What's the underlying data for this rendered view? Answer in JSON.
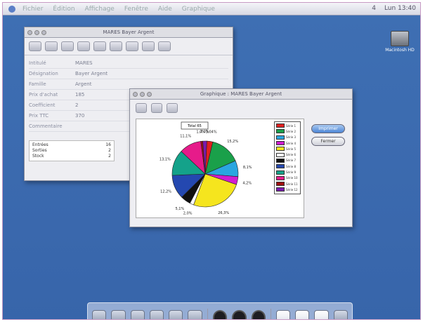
{
  "menubar": {
    "items": [
      "Fichier",
      "Édition",
      "Affichage",
      "Fenêtre",
      "Aide",
      "Graphique"
    ],
    "status": "4",
    "clock": "Lun 13:40"
  },
  "desktop": {
    "disk_label": "Macintosh HD"
  },
  "record_window": {
    "title": "MARES Bayer Argent",
    "fields": [
      {
        "label": "Intitulé",
        "value": "MARES"
      },
      {
        "label": "Désignation",
        "value": "Bayer Argent"
      },
      {
        "label": "Famille",
        "value": "Argent"
      },
      {
        "label": "Prix d'achat",
        "value": "185"
      },
      {
        "label": "Coefficient",
        "value": "2"
      },
      {
        "label": "Prix TTC",
        "value": "370"
      },
      {
        "label": "Commentaire",
        "value": ""
      }
    ],
    "stats": [
      {
        "label": "Entrées",
        "value": "16"
      },
      {
        "label": "Sorties",
        "value": "2"
      },
      {
        "label": "Stock",
        "value": "2"
      }
    ]
  },
  "graph_window": {
    "title": "Graphique : MARES Bayer Argent",
    "callout": "Total 65",
    "buttons": {
      "print": "Imprimer",
      "close": "Fermer"
    }
  },
  "chart_data": {
    "type": "pie",
    "title": "",
    "slices": [
      {
        "name": "Série 1",
        "value": 3,
        "color": "#e02020",
        "label": "3,04%"
      },
      {
        "name": "Série 2",
        "value": 15,
        "color": "#1aa04a",
        "label": "15,2%"
      },
      {
        "name": "Série 3",
        "value": 8,
        "color": "#2aa6e0",
        "label": "8,1%"
      },
      {
        "name": "Série 4",
        "value": 4,
        "color": "#d01dd0",
        "label": "4,2%"
      },
      {
        "name": "Série 5",
        "value": 26,
        "color": "#f5e51e",
        "label": "26,3%"
      },
      {
        "name": "Série 6",
        "value": 2,
        "color": "#ffffff",
        "label": "2,0%"
      },
      {
        "name": "Série 7",
        "value": 5,
        "color": "#101010",
        "label": "5,1%"
      },
      {
        "name": "Série 8",
        "value": 12,
        "color": "#2448b0",
        "label": "12,2%"
      },
      {
        "name": "Série 9",
        "value": 13,
        "color": "#14a28a",
        "label": "13,1%"
      },
      {
        "name": "Série 10",
        "value": 11,
        "color": "#e61b8a",
        "label": "11,1%"
      },
      {
        "name": "Série 11",
        "value": 1,
        "color": "#a01010",
        "label": "1,0%"
      },
      {
        "name": "Série 12",
        "value": 2,
        "color": "#7a1ab0",
        "label": "2,0%"
      }
    ],
    "legend": "right"
  },
  "dock": {
    "icons": [
      "finder-icon",
      "app-icon-1",
      "app-icon-2",
      "system-prefs-icon",
      "app-icon-3",
      "app-icon-4",
      "app-icon-5",
      "down-arrow-icon",
      "down-arrow-icon",
      "down-arrow-icon",
      "document-icon",
      "document-icon",
      "folder-icon",
      "trash-icon"
    ]
  }
}
